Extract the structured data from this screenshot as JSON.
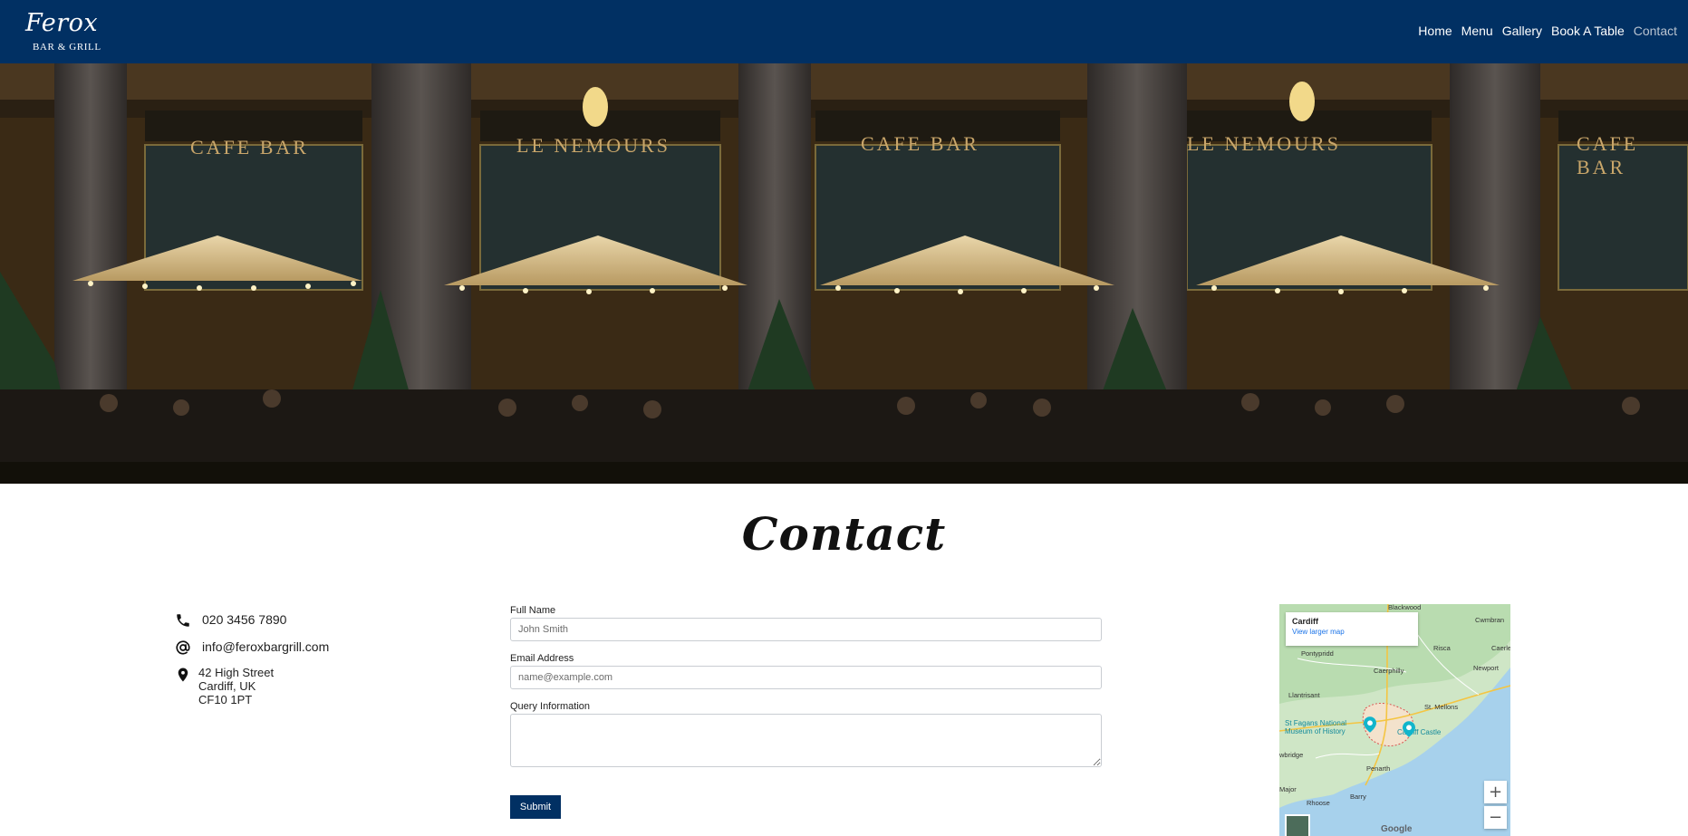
{
  "header": {
    "brand_name": "Ferox",
    "brand_sub": "BAR & GRILL",
    "bg_color": "#013063",
    "nav": [
      {
        "label": "Home"
      },
      {
        "label": "Menu"
      },
      {
        "label": "Gallery"
      },
      {
        "label": "Book A Table"
      },
      {
        "label": "Contact",
        "active": true
      }
    ]
  },
  "hero": {
    "signs": [
      "CAFE BAR",
      "LE NEMOURS",
      "CAFE BAR",
      "LE NEMOURS",
      "CAFE BAR"
    ]
  },
  "page_title": "Contact",
  "contact_info": {
    "phone": "020 3456 7890",
    "email": "info@feroxbargrill.com",
    "address": [
      "42 High Street",
      "Cardiff, UK",
      "CF10 1PT"
    ],
    "icons": [
      "phone-icon",
      "at-icon",
      "location-pin-icon"
    ]
  },
  "form": {
    "full_name_label": "Full Name",
    "full_name_placeholder": "John Smith",
    "email_label": "Email Address",
    "email_placeholder": "name@example.com",
    "query_label": "Query Information",
    "submit_label": "Submit"
  },
  "map": {
    "card_title": "Cardiff",
    "card_link": "View larger map",
    "labels": {
      "blackwood": "Blackwood",
      "cwmbran": "Cwmbran",
      "pontypridd": "Pontypridd",
      "risca": "Risca",
      "caerleon": "Caerle",
      "caerphilly": "Caerphilly",
      "newport": "Newport",
      "llantrisant": "Llantrisant",
      "st_mellons": "St. Mellons",
      "st_fagans": "St Fagans National Museum of History",
      "cardiff_castle": "Cardiff Castle",
      "cowbridge": "wbridge",
      "penarth": "Penarth",
      "barry": "Barry",
      "rhoose": "Rhoose",
      "llantwit": "Major"
    },
    "zoom_in": "+",
    "zoom_out": "−",
    "logo": "Google"
  }
}
